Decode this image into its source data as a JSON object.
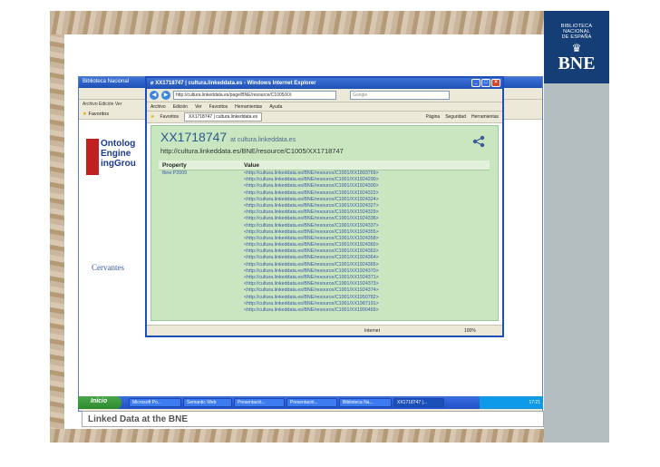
{
  "slide": {
    "caption": "Linked Data at the BNE",
    "logo_small_lines": [
      "BIBLIOTECA",
      "NACIONAL",
      "DE ESPAÑA"
    ],
    "logo_text": "BNE"
  },
  "background_window": {
    "title": "Biblioteca Nacional",
    "menu": "Archivo  Edición  Ver",
    "favorites_label": "Favoritos",
    "logo_lines": [
      "Ontolog",
      "Engine",
      "ingGrou"
    ],
    "cervantes": "Cervantes",
    "status_url": "http://cultura.linkeddata.es/BNE/resource/C1005/XX1718747",
    "status_zone": "Internet",
    "status_zoom": "100%"
  },
  "taskbar": {
    "start_label": "Inicio",
    "buttons": [
      "Microsoft Po...",
      "Semantic Web",
      "Presentació...",
      "Presentació...",
      "Biblioteca Na...",
      "XX1718747 |..."
    ],
    "clock": "17:21"
  },
  "front_window": {
    "title": "XX1718747 | cultura.linkeddata.es - Windows Internet Explorer",
    "address": "http://cultura.linkeddata.es/page/BNE/resource/C1005/XX",
    "search_placeholder": "Google",
    "menu": [
      "Archivo",
      "Edición",
      "Ver",
      "Favoritos",
      "Herramientas",
      "Ayuda"
    ],
    "favorites_label": "Favoritos",
    "tab_label": "XX1718747 | cultura.linkeddata.es",
    "tools": [
      "Página",
      "Seguridad",
      "Herramientas"
    ],
    "status_zone": "Internet",
    "status_zoom": "100%"
  },
  "resource": {
    "id": "XX1718747",
    "at": "at cultura.linkeddata.es",
    "uri": "http://cultura.linkeddata.es/BNE/resource/C1005/XX1718747",
    "col_property": "Property",
    "col_value": "Value",
    "property": "fbne:P2009",
    "values": [
      "<http://cultura.linkeddata.es/BNE/resource/C1001/XX1893769>",
      "<http://cultura.linkeddata.es/BNE/resource/C1001/XX1924290>",
      "<http://cultura.linkeddata.es/BNE/resource/C1001/XX1924300>",
      "<http://cultura.linkeddata.es/BNE/resource/C1001/XX1924322>",
      "<http://cultura.linkeddata.es/BNE/resource/C1001/XX1924324>",
      "<http://cultura.linkeddata.es/BNE/resource/C1001/XX1924327>",
      "<http://cultura.linkeddata.es/BNE/resource/C1001/XX1924329>",
      "<http://cultura.linkeddata.es/BNE/resource/C1001/XX1924336>",
      "<http://cultura.linkeddata.es/BNE/resource/C1001/XX1924337>",
      "<http://cultura.linkeddata.es/BNE/resource/C1001/XX1924355>",
      "<http://cultura.linkeddata.es/BNE/resource/C1001/XX1924358>",
      "<http://cultura.linkeddata.es/BNE/resource/C1001/XX1924360>",
      "<http://cultura.linkeddata.es/BNE/resource/C1001/XX1924363>",
      "<http://cultura.linkeddata.es/BNE/resource/C1001/XX1924364>",
      "<http://cultura.linkeddata.es/BNE/resource/C1001/XX1924365>",
      "<http://cultura.linkeddata.es/BNE/resource/C1001/XX1924370>",
      "<http://cultura.linkeddata.es/BNE/resource/C1001/XX1924371>",
      "<http://cultura.linkeddata.es/BNE/resource/C1001/XX1924373>",
      "<http://cultura.linkeddata.es/BNE/resource/C1001/XX1924374>",
      "<http://cultura.linkeddata.es/BNE/resource/C1001/XX1950782>",
      "<http://cultura.linkeddata.es/BNE/resource/C1001/XX1987191>",
      "<http://cultura.linkeddata.es/BNE/resource/C1001/XX1990469>"
    ]
  },
  "colors": {
    "bne_blue": "#153e77",
    "xp_blue": "#1f4fb4",
    "content_green": "#c9e6c0",
    "link_blue": "#3655a8"
  }
}
